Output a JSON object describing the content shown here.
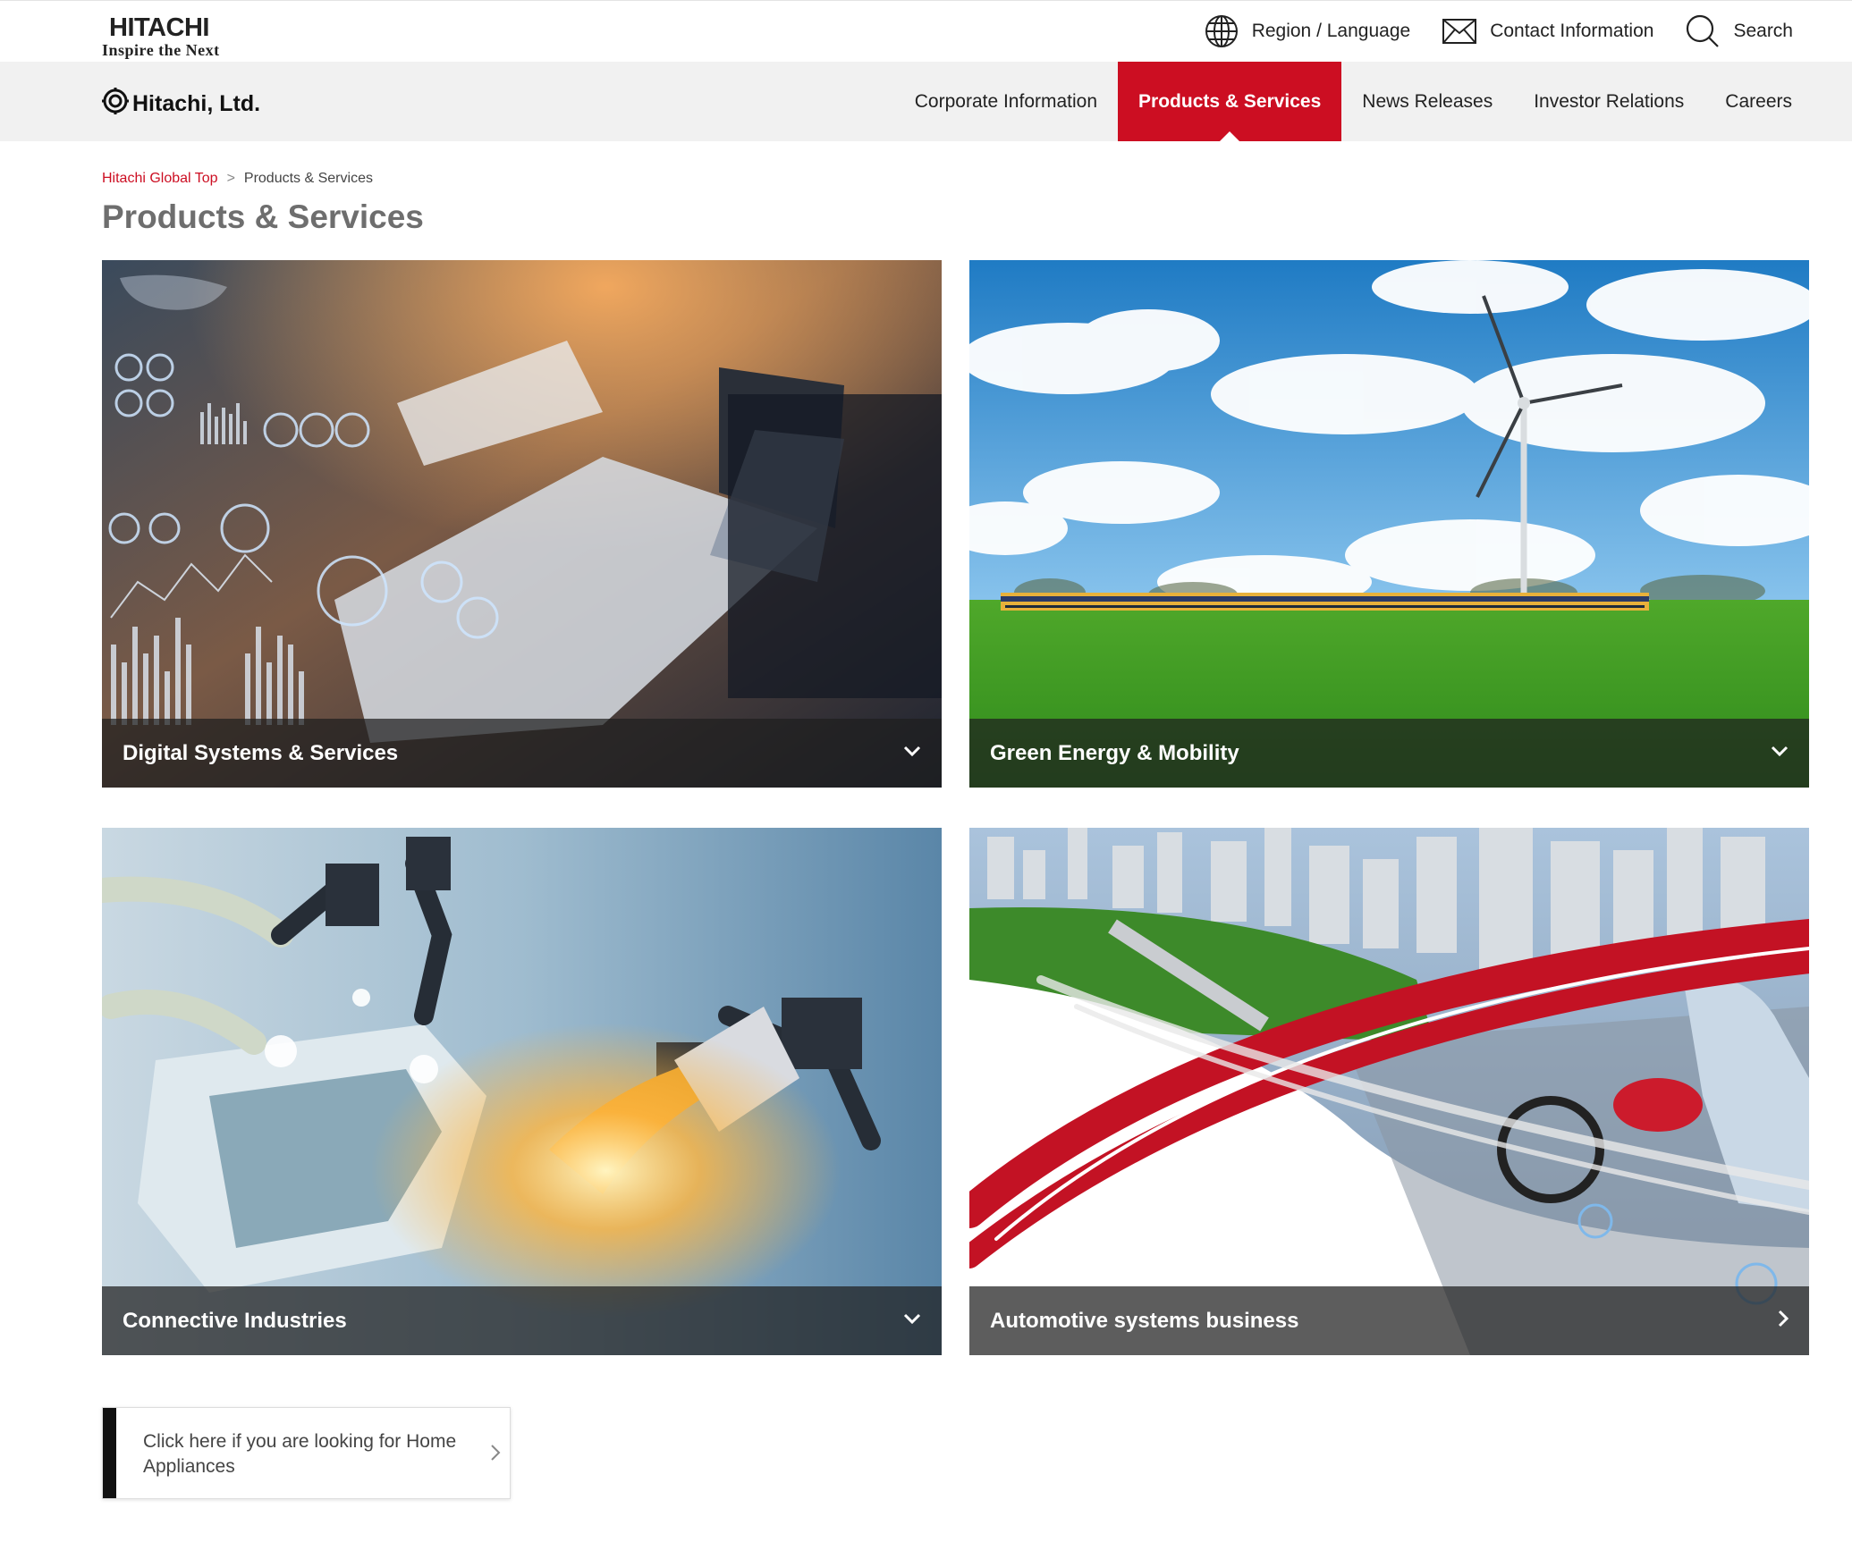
{
  "header": {
    "logo": {
      "wordmark": "HITACHI",
      "tagline": "Inspire the Next"
    },
    "utilities": [
      {
        "label": "Region / Language",
        "icon": "globe-icon"
      },
      {
        "label": "Contact Information",
        "icon": "mail-icon"
      },
      {
        "label": "Search",
        "icon": "search-icon"
      }
    ]
  },
  "nav": {
    "brand": "Hitachi, Ltd.",
    "items": [
      {
        "label": "Corporate Information",
        "active": false
      },
      {
        "label": "Products & Services",
        "active": true
      },
      {
        "label": "News Releases",
        "active": false
      },
      {
        "label": "Investor Relations",
        "active": false
      },
      {
        "label": "Careers",
        "active": false
      }
    ]
  },
  "breadcrumb": {
    "home": "Hitachi Global Top",
    "separator": ">",
    "current": "Products & Services"
  },
  "page": {
    "title": "Products & Services"
  },
  "tiles": [
    {
      "label": "Digital Systems & Services",
      "chevron": "chevron-down-icon"
    },
    {
      "label": "Green Energy & Mobility",
      "chevron": "chevron-down-icon"
    },
    {
      "label": "Connective Industries",
      "chevron": "chevron-down-icon"
    },
    {
      "label": "Automotive systems business",
      "chevron": "chevron-right-icon"
    }
  ],
  "home_appliances": {
    "text": "Click here if you are looking for Home Appliances"
  },
  "colors": {
    "brand_red": "#cc0e22",
    "nav_bg": "#f1f1f1",
    "title_gray": "#6e6e6e"
  }
}
